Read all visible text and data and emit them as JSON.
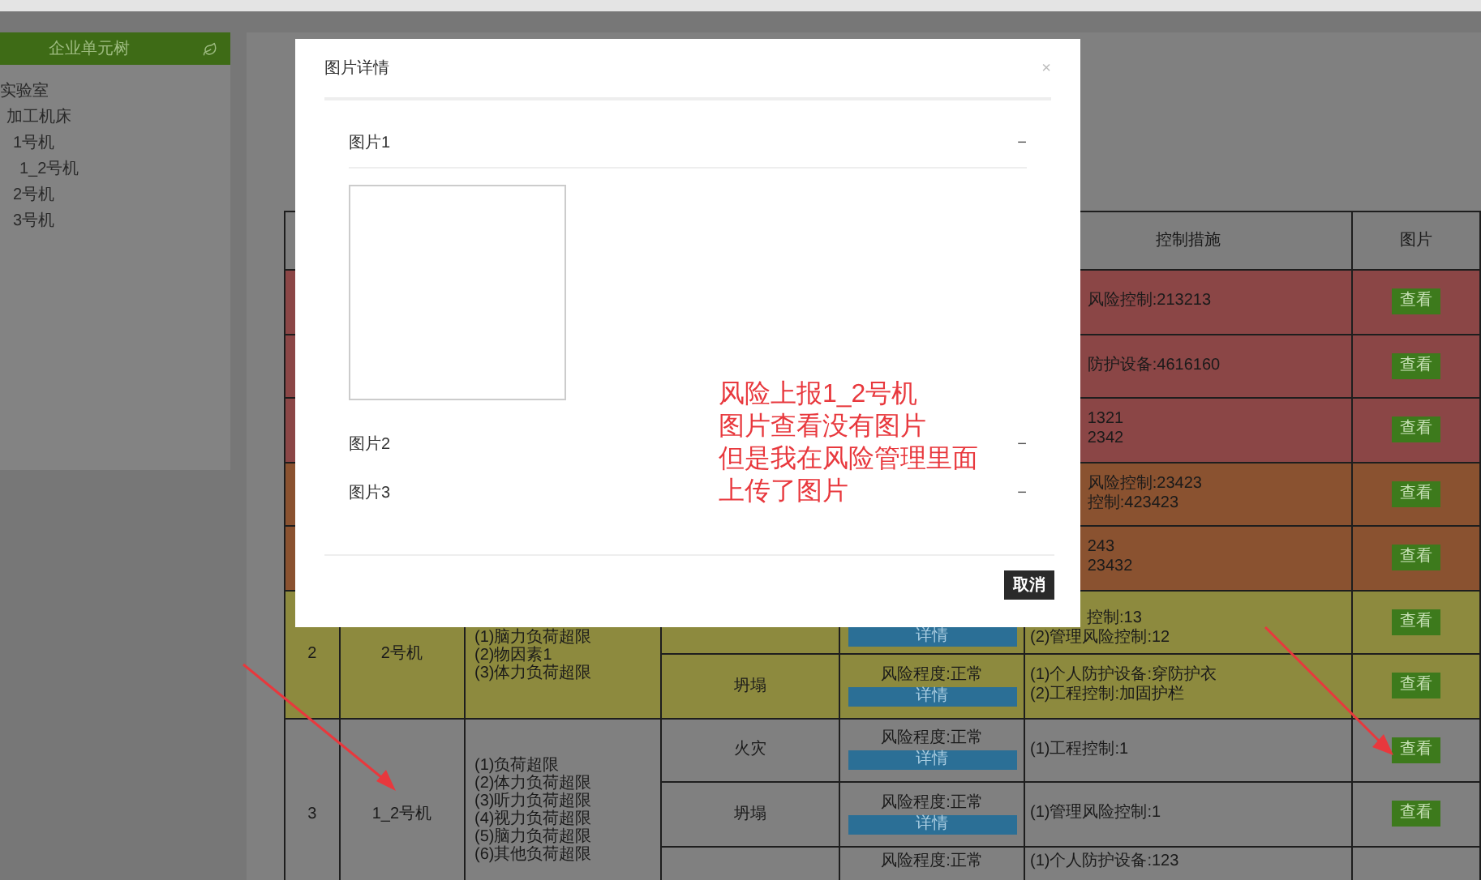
{
  "sidebar": {
    "title": "企业单元树",
    "tree": [
      {
        "label": "实验室",
        "children": [
          {
            "label": "加工机床",
            "children": [
              {
                "label": "1号机",
                "children": [
                  {
                    "label": "1_2号机"
                  }
                ]
              },
              {
                "label": "2号机"
              },
              {
                "label": "3号机"
              }
            ]
          }
        ]
      }
    ]
  },
  "table": {
    "columns": [
      "控制措施",
      "图片"
    ],
    "groups": [
      {
        "kind": "covered",
        "rows": [
          {
            "color": "#8b4646",
            "control": [
              "风险控制:213213"
            ],
            "view": "查看"
          },
          {
            "color": "#8b4646",
            "control": [
              "防护设备:4616160"
            ],
            "view": "查看"
          },
          {
            "color": "#8b4646",
            "control": [
              "1321",
              "2342"
            ],
            "view": "查看"
          },
          {
            "color": "#8a5230",
            "control": [
              "风险控制:23423",
              "控制:423423"
            ],
            "view": "查看"
          },
          {
            "color": "#8a5230",
            "control": [
              "243",
              "23432"
            ],
            "view": "查看"
          }
        ]
      },
      {
        "kind": "full",
        "number": "2",
        "name": "2号机",
        "factors": [
          "(1)脑力负荷超限",
          "(2)物因素1",
          "(3)体力负荷超限"
        ],
        "rows": [
          {
            "color": "#8d8a3e",
            "covered_top": true,
            "detail": "详情",
            "control": [
              "控制:13",
              "(2)管理风险控制:12"
            ],
            "view": "查看"
          },
          {
            "color": "#8d8a3e",
            "risk": "坍塌",
            "level": "风险程度:正常",
            "detail": "详情",
            "control": [
              "(1)个人防护设备:穿防护衣",
              "(2)工程控制:加固护栏"
            ],
            "view": "查看"
          }
        ]
      },
      {
        "kind": "full",
        "number": "3",
        "name": "1_2号机",
        "factors": [
          "(1)负荷超限",
          "(2)体力负荷超限",
          "(3)听力负荷超限",
          "(4)视力负荷超限",
          "(5)脑力负荷超限",
          "(6)其他负荷超限"
        ],
        "rows": [
          {
            "color": "#808080",
            "risk": "火灾",
            "level": "风险程度:正常",
            "detail": "详情",
            "control": [
              "(1)工程控制:1"
            ],
            "view": "查看"
          },
          {
            "color": "#808080",
            "risk": "坍塌",
            "level": "风险程度:正常",
            "detail": "详情",
            "control": [
              "(1)管理风险控制:1"
            ],
            "view": "查看"
          },
          {
            "color": "#808080",
            "level": "风险程度:正常",
            "control": [
              "(1)个人防护设备:123"
            ]
          }
        ]
      }
    ]
  },
  "modal": {
    "title": "图片详情",
    "close": "×",
    "sections": [
      {
        "label": "图片1",
        "toggle": "−",
        "expanded": true
      },
      {
        "label": "图片2",
        "toggle": "−",
        "expanded": false
      },
      {
        "label": "图片3",
        "toggle": "−",
        "expanded": false
      }
    ],
    "cancel": "取消"
  },
  "annotation": {
    "lines": [
      "风险上报1_2号机",
      "图片查看没有图片",
      "但是我在风险管理里面",
      "上传了图片"
    ]
  }
}
